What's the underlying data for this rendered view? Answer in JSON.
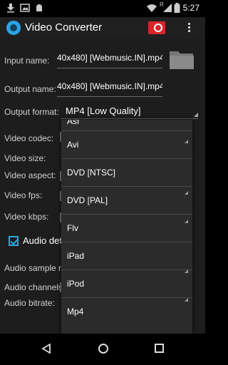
{
  "status_bar": {
    "time": "5:27",
    "network_indicator": "R",
    "icons": [
      "download-icon",
      "image-icon",
      "android-icon",
      "wifi-icon",
      "signal-icon",
      "battery-icon"
    ]
  },
  "action_bar": {
    "title": "Video Converter",
    "icons": [
      "app-logo-icon",
      "convert-icon",
      "overflow-menu-icon"
    ]
  },
  "form": {
    "input_name_label": "Input name:",
    "input_name_value": "40x480] [Webmusic.IN].mp4",
    "output_name_label": "Output name:",
    "output_name_value": "40x480] [Webmusic.IN].mp4",
    "output_format_label": "Output format:",
    "output_format_value": "MP4 [Low Quality]",
    "video_codec_label": "Video codec:",
    "video_size_label": "Video size:",
    "video_aspect_label": "Video aspect:",
    "video_fps_label": "Video fps:",
    "video_kbps_label": "Video kbps:",
    "audio_detect_label": "Audio det",
    "audio_detect_checked": true,
    "audio_sample_rate_label": "Audio sample ra",
    "audio_channels_label": "Audio channels:",
    "audio_bitrate_label": "Audio bitrate:"
  },
  "dropdown": {
    "options": [
      "Asf",
      "Avi",
      "DVD [NTSC]",
      "DVD [PAL]",
      "Flv",
      "iPad",
      "iPod",
      "Mp4"
    ]
  },
  "colors": {
    "accent": "#2fa7d6",
    "convert_button": "#d8262a",
    "background": "#1d1d1d",
    "dropdown_bg": "#2b2b2b"
  },
  "nav_bar": {
    "icons": [
      "back-icon",
      "home-icon",
      "recents-icon"
    ]
  }
}
